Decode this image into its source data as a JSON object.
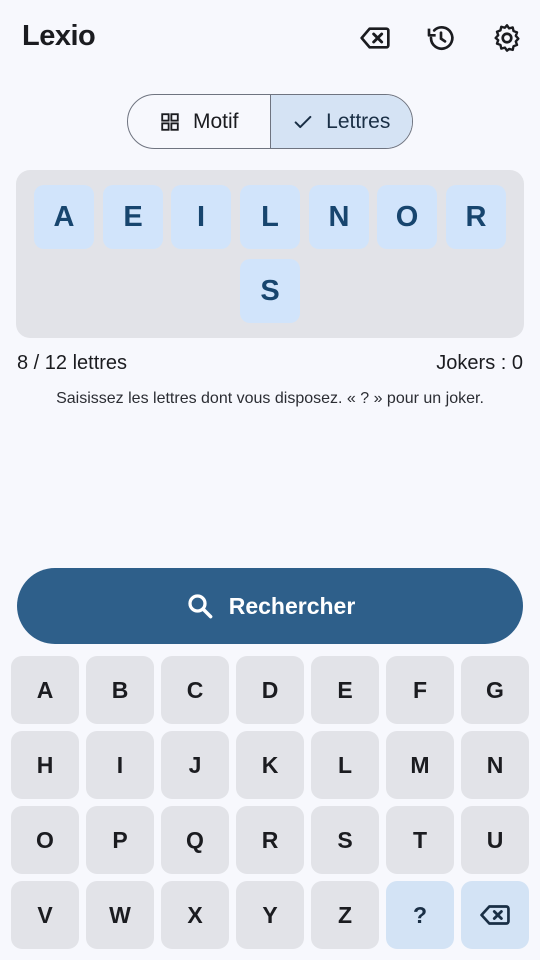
{
  "app": {
    "title": "Lexio"
  },
  "toolbar": {
    "icons": [
      "backspace-clear-icon",
      "history-icon",
      "settings-gear-icon"
    ]
  },
  "mode_toggle": {
    "options": [
      {
        "label": "Motif",
        "icon": "grid-icon",
        "selected": false
      },
      {
        "label": "Lettres",
        "icon": "check-icon",
        "selected": true
      }
    ]
  },
  "letters": [
    "A",
    "E",
    "I",
    "L",
    "N",
    "O",
    "R",
    "S"
  ],
  "status": {
    "count": "8 / 12 lettres",
    "jokers": "Jokers : 0"
  },
  "hint": "Saisissez les lettres dont vous disposez. « ? » pour un joker.",
  "search_button": {
    "label": "Rechercher",
    "icon": "search-icon"
  },
  "keyboard": {
    "rows": [
      [
        "A",
        "B",
        "C",
        "D",
        "E",
        "F",
        "G"
      ],
      [
        "H",
        "I",
        "J",
        "K",
        "L",
        "M",
        "N"
      ],
      [
        "O",
        "P",
        "Q",
        "R",
        "S",
        "T",
        "U"
      ],
      [
        "V",
        "W",
        "X",
        "Y",
        "Z",
        "?",
        ""
      ]
    ],
    "joker_key": "?",
    "backspace_icon": "backspace-icon"
  },
  "colors": {
    "background": "#f7f8fd",
    "accent": "#2e5f8a",
    "tile_bg": "#d1e4fb",
    "tile_text": "#17456e",
    "key_bg": "#e2e3e8",
    "special_key_bg": "#d3e3f5",
    "segment_selected": "#d5e3f4"
  }
}
